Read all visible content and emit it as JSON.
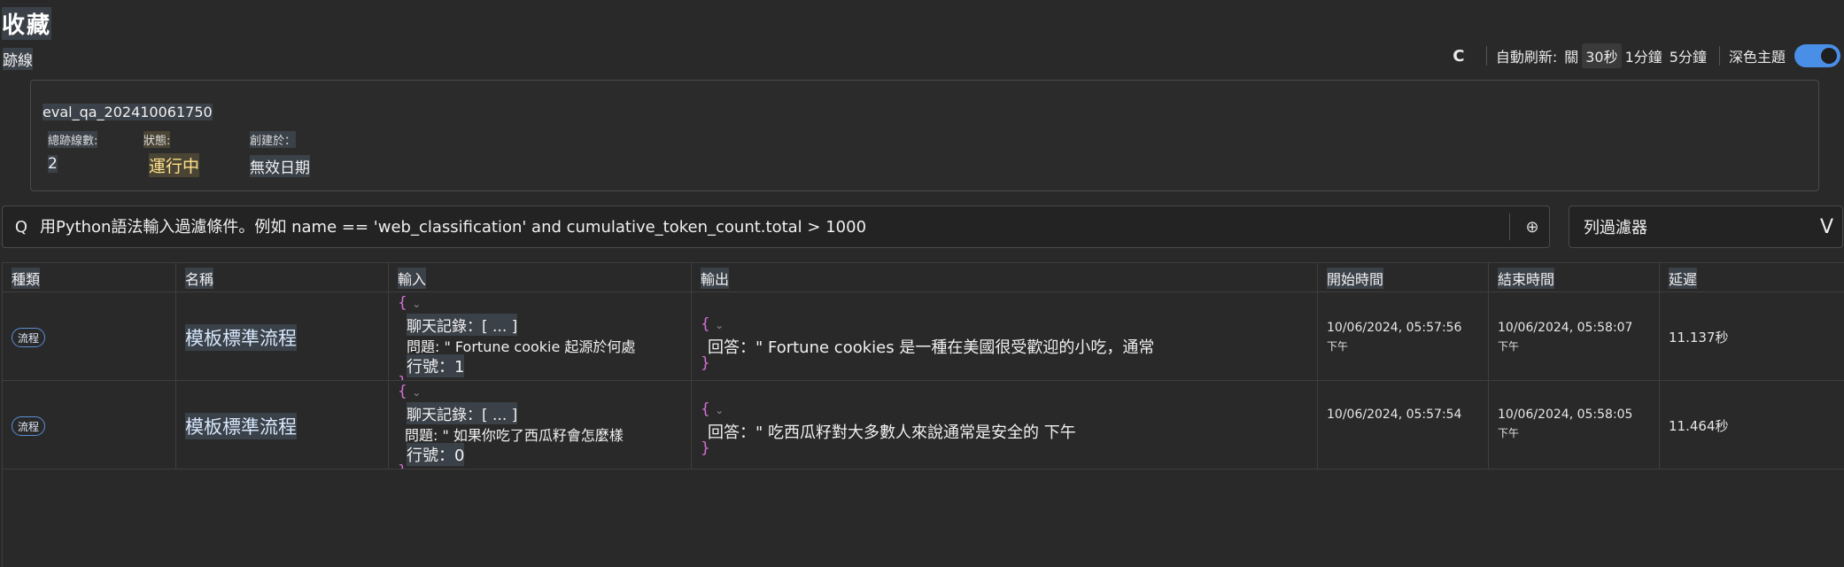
{
  "page_title": "收藏",
  "traces_label": "跡線",
  "toolbar": {
    "refresh_icon": "C",
    "auto_refresh_label": "自動刷新:",
    "options": [
      "關",
      "30秒",
      "1分鐘",
      "5分鐘"
    ],
    "selected_option": "30秒",
    "dark_theme_label": "深色主題",
    "dark_theme_on": true
  },
  "run": {
    "name": "eval_qa_202410061750",
    "total_traces_label": "總跡線數:",
    "total_traces_value": "2",
    "status_label": "狀態:",
    "status_value": "運行中",
    "created_label": "創建於：",
    "created_value": "無效日期"
  },
  "filter": {
    "search_icon": "Q",
    "placeholder": "用Python語法輸入過濾條件。例如 name == 'web_classification' and cumulative_token_count.total > 1000",
    "column_filter_label": "列過濾器",
    "chevron": "V"
  },
  "table": {
    "headers": [
      "種類",
      "名稱",
      "輸入",
      "輸出",
      "開始時間",
      "結束時間",
      "延遲"
    ],
    "rows": [
      {
        "kind": "流程",
        "name": "模板標準流程",
        "input_open": "{",
        "input_history": "聊天記錄：[ ... ]",
        "input_question": "問題: \" Fortune cookie 起源於何處",
        "input_line": "行號：1",
        "input_close": "}",
        "output_open": "{",
        "output_answer": "回答：\" Fortune cookies 是一種在美國很受歡迎的小吃，通常",
        "output_close": "}",
        "start_time": "10/06/2024, 05:57:56",
        "start_ampm": "下午",
        "end_time": "10/06/2024, 05:58:07",
        "end_ampm": "下午",
        "latency": "11.137秒"
      },
      {
        "kind": "流程",
        "name": "模板標準流程",
        "input_open": "{",
        "input_history": "聊天記錄：[ ... ]",
        "input_question": "問題: \" 如果你吃了西瓜籽會怎麼樣",
        "input_line": "行號：0",
        "input_close": "}",
        "output_open": "{",
        "output_answer": "回答：\" 吃西瓜籽對大多數人來說通常是安全的 下午",
        "output_close": "}",
        "start_time": "10/06/2024, 05:57:54",
        "start_ampm": "",
        "end_time": "10/06/2024, 05:58:05",
        "end_ampm": "下午",
        "latency": "11.464秒"
      }
    ]
  },
  "colors": {
    "background": "#292929",
    "accent": "#4a8fe7",
    "brace": "#d770d7",
    "running": "#ffe08a"
  }
}
